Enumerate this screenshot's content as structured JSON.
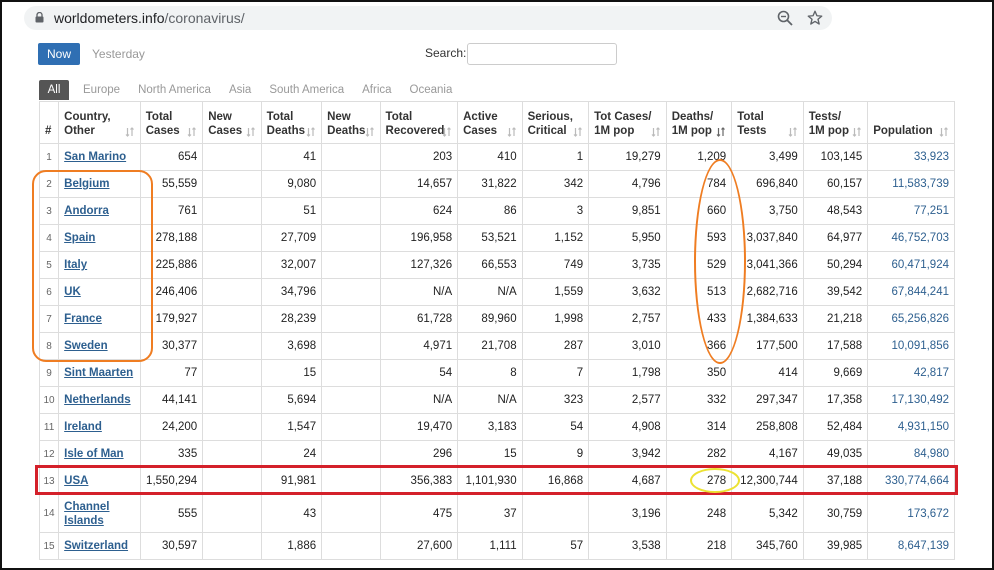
{
  "browser": {
    "domain": "worldometers.info",
    "path": "/coronavirus/"
  },
  "controls": {
    "now_label": "Now",
    "yesterday_label": "Yesterday",
    "search_label": "Search:"
  },
  "region_tabs": [
    "All",
    "Europe",
    "North America",
    "Asia",
    "South America",
    "Africa",
    "Oceania"
  ],
  "columns": [
    {
      "line1": "#",
      "line2": ""
    },
    {
      "line1": "Country,",
      "line2": "Other"
    },
    {
      "line1": "Total",
      "line2": "Cases"
    },
    {
      "line1": "New",
      "line2": "Cases"
    },
    {
      "line1": "Total",
      "line2": "Deaths"
    },
    {
      "line1": "New",
      "line2": "Deaths"
    },
    {
      "line1": "Total",
      "line2": "Recovered"
    },
    {
      "line1": "Active",
      "line2": "Cases"
    },
    {
      "line1": "Serious,",
      "line2": "Critical"
    },
    {
      "line1": "Tot Cases/",
      "line2": "1M pop"
    },
    {
      "line1": "Deaths/",
      "line2": "1M pop"
    },
    {
      "line1": "Total",
      "line2": "Tests"
    },
    {
      "line1": "Tests/",
      "line2": "1M pop"
    },
    {
      "line1": "",
      "line2": "Population"
    }
  ],
  "rows": [
    {
      "rank": "1",
      "country_lines": [
        "San Marino"
      ],
      "total_cases": "654",
      "new_cases": "",
      "total_deaths": "41",
      "new_deaths": "",
      "total_recovered": "203",
      "active_cases": "410",
      "serious_critical": "1",
      "tot_cases_per_1m": "19,279",
      "deaths_per_1m": "1,209",
      "total_tests": "3,499",
      "tests_per_1m": "103,145",
      "population": "33,923"
    },
    {
      "rank": "2",
      "country_lines": [
        "Belgium"
      ],
      "total_cases": "55,559",
      "new_cases": "",
      "total_deaths": "9,080",
      "new_deaths": "",
      "total_recovered": "14,657",
      "active_cases": "31,822",
      "serious_critical": "342",
      "tot_cases_per_1m": "4,796",
      "deaths_per_1m": "784",
      "total_tests": "696,840",
      "tests_per_1m": "60,157",
      "population": "11,583,739"
    },
    {
      "rank": "3",
      "country_lines": [
        "Andorra"
      ],
      "total_cases": "761",
      "new_cases": "",
      "total_deaths": "51",
      "new_deaths": "",
      "total_recovered": "624",
      "active_cases": "86",
      "serious_critical": "3",
      "tot_cases_per_1m": "9,851",
      "deaths_per_1m": "660",
      "total_tests": "3,750",
      "tests_per_1m": "48,543",
      "population": "77,251"
    },
    {
      "rank": "4",
      "country_lines": [
        "Spain"
      ],
      "total_cases": "278,188",
      "new_cases": "",
      "total_deaths": "27,709",
      "new_deaths": "",
      "total_recovered": "196,958",
      "active_cases": "53,521",
      "serious_critical": "1,152",
      "tot_cases_per_1m": "5,950",
      "deaths_per_1m": "593",
      "total_tests": "3,037,840",
      "tests_per_1m": "64,977",
      "population": "46,752,703"
    },
    {
      "rank": "5",
      "country_lines": [
        "Italy"
      ],
      "total_cases": "225,886",
      "new_cases": "",
      "total_deaths": "32,007",
      "new_deaths": "",
      "total_recovered": "127,326",
      "active_cases": "66,553",
      "serious_critical": "749",
      "tot_cases_per_1m": "3,735",
      "deaths_per_1m": "529",
      "total_tests": "3,041,366",
      "tests_per_1m": "50,294",
      "population": "60,471,924"
    },
    {
      "rank": "6",
      "country_lines": [
        "UK"
      ],
      "total_cases": "246,406",
      "new_cases": "",
      "total_deaths": "34,796",
      "new_deaths": "",
      "total_recovered": "N/A",
      "active_cases": "N/A",
      "serious_critical": "1,559",
      "tot_cases_per_1m": "3,632",
      "deaths_per_1m": "513",
      "total_tests": "2,682,716",
      "tests_per_1m": "39,542",
      "population": "67,844,241"
    },
    {
      "rank": "7",
      "country_lines": [
        "France"
      ],
      "total_cases": "179,927",
      "new_cases": "",
      "total_deaths": "28,239",
      "new_deaths": "",
      "total_recovered": "61,728",
      "active_cases": "89,960",
      "serious_critical": "1,998",
      "tot_cases_per_1m": "2,757",
      "deaths_per_1m": "433",
      "total_tests": "1,384,633",
      "tests_per_1m": "21,218",
      "population": "65,256,826"
    },
    {
      "rank": "8",
      "country_lines": [
        "Sweden"
      ],
      "total_cases": "30,377",
      "new_cases": "",
      "total_deaths": "3,698",
      "new_deaths": "",
      "total_recovered": "4,971",
      "active_cases": "21,708",
      "serious_critical": "287",
      "tot_cases_per_1m": "3,010",
      "deaths_per_1m": "366",
      "total_tests": "177,500",
      "tests_per_1m": "17,588",
      "population": "10,091,856"
    },
    {
      "rank": "9",
      "country_lines": [
        "Sint Maarten"
      ],
      "total_cases": "77",
      "new_cases": "",
      "total_deaths": "15",
      "new_deaths": "",
      "total_recovered": "54",
      "active_cases": "8",
      "serious_critical": "7",
      "tot_cases_per_1m": "1,798",
      "deaths_per_1m": "350",
      "total_tests": "414",
      "tests_per_1m": "9,669",
      "population": "42,817"
    },
    {
      "rank": "10",
      "country_lines": [
        "Netherlands"
      ],
      "total_cases": "44,141",
      "new_cases": "",
      "total_deaths": "5,694",
      "new_deaths": "",
      "total_recovered": "N/A",
      "active_cases": "N/A",
      "serious_critical": "323",
      "tot_cases_per_1m": "2,577",
      "deaths_per_1m": "332",
      "total_tests": "297,347",
      "tests_per_1m": "17,358",
      "population": "17,130,492"
    },
    {
      "rank": "11",
      "country_lines": [
        "Ireland"
      ],
      "total_cases": "24,200",
      "new_cases": "",
      "total_deaths": "1,547",
      "new_deaths": "",
      "total_recovered": "19,470",
      "active_cases": "3,183",
      "serious_critical": "54",
      "tot_cases_per_1m": "4,908",
      "deaths_per_1m": "314",
      "total_tests": "258,808",
      "tests_per_1m": "52,484",
      "population": "4,931,150"
    },
    {
      "rank": "12",
      "country_lines": [
        "Isle of Man"
      ],
      "total_cases": "335",
      "new_cases": "",
      "total_deaths": "24",
      "new_deaths": "",
      "total_recovered": "296",
      "active_cases": "15",
      "serious_critical": "9",
      "tot_cases_per_1m": "3,942",
      "deaths_per_1m": "282",
      "total_tests": "4,167",
      "tests_per_1m": "49,035",
      "population": "84,980"
    },
    {
      "rank": "13",
      "country_lines": [
        "USA"
      ],
      "total_cases": "1,550,294",
      "new_cases": "",
      "total_deaths": "91,981",
      "new_deaths": "",
      "total_recovered": "356,383",
      "active_cases": "1,101,930",
      "serious_critical": "16,868",
      "tot_cases_per_1m": "4,687",
      "deaths_per_1m": "278",
      "total_tests": "12,300,744",
      "tests_per_1m": "37,188",
      "population": "330,774,664"
    },
    {
      "rank": "14",
      "country_lines": [
        "Channel",
        "Islands"
      ],
      "total_cases": "555",
      "new_cases": "",
      "total_deaths": "43",
      "new_deaths": "",
      "total_recovered": "475",
      "active_cases": "37",
      "serious_critical": "",
      "tot_cases_per_1m": "3,196",
      "deaths_per_1m": "248",
      "total_tests": "5,342",
      "tests_per_1m": "30,759",
      "population": "173,672"
    },
    {
      "rank": "15",
      "country_lines": [
        "Switzerland"
      ],
      "total_cases": "30,597",
      "new_cases": "",
      "total_deaths": "1,886",
      "new_deaths": "",
      "total_recovered": "27,600",
      "active_cases": "1,111",
      "serious_critical": "57",
      "tot_cases_per_1m": "3,538",
      "deaths_per_1m": "218",
      "total_tests": "345,760",
      "tests_per_1m": "39,985",
      "population": "8,647,139"
    }
  ],
  "colors": {
    "active_button": "#2f6fb3",
    "link": "#2d5f8f",
    "highlight_orange": "#ef7d22",
    "highlight_red": "#d4202a",
    "highlight_yellow": "#ece232"
  },
  "icons": {
    "lock": "lock-icon",
    "zoom": "zoom-icon",
    "bookmark": "star-icon",
    "sort": "sort-arrows-icon",
    "sort_active": "sort-descending-icon"
  }
}
